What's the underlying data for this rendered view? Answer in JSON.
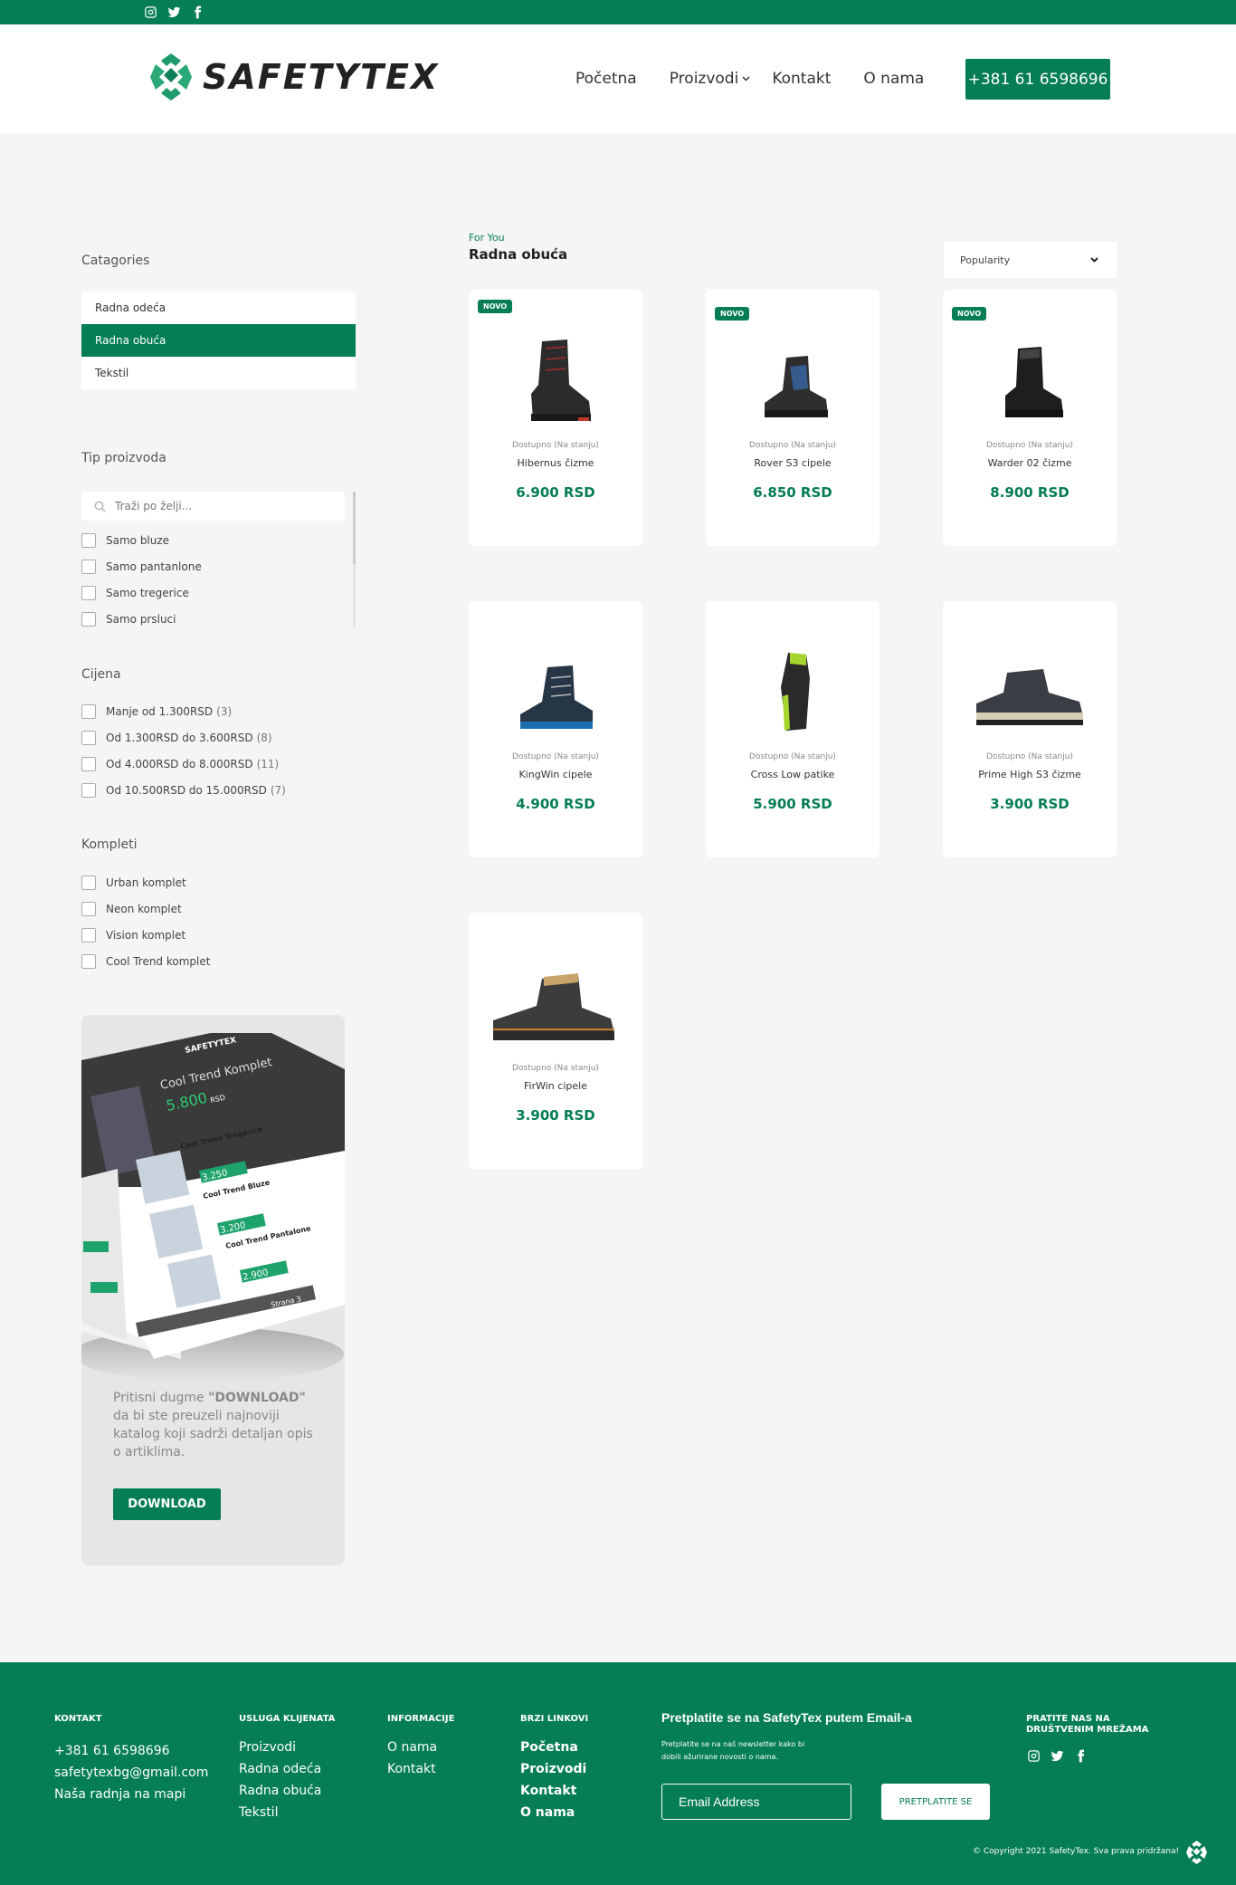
{
  "brand": {
    "name": "SAFETYTEX",
    "color": "#057d56"
  },
  "top_social": [
    "instagram-icon",
    "twitter-icon",
    "facebook-icon"
  ],
  "nav": {
    "items": [
      "Početna",
      "Proizvodi",
      "Kontakt",
      "O nama"
    ],
    "phone": "+381 61 6598696"
  },
  "sidebar": {
    "categories_title": "Catagories",
    "categories": [
      "Radna odeća",
      "Radna obuća",
      "Tekstil"
    ],
    "active_category": "Radna obuća",
    "type_title": "Tip proizvoda",
    "search_placeholder": "Traži po želji...",
    "types": [
      "Samo bluze",
      "Samo pantanlone",
      "Samo tregerice",
      "Samo prsluci"
    ],
    "price_title": "Cijena",
    "prices": [
      {
        "label": "Manje od 1.300RSD",
        "count": "(3)"
      },
      {
        "label": "Od 1.300RSD do 3.600RSD",
        "count": "(8)"
      },
      {
        "label": "Od 4.000RSD do 8.000RSD",
        "count": "(11)"
      },
      {
        "label": "Od 10.500RSD do 15.000RSD",
        "count": "(7)"
      }
    ],
    "sets_title": "Kompleti",
    "sets": [
      "Urban komplet",
      "Neon komplet",
      "Vision komplet",
      "Cool Trend komplet"
    ]
  },
  "promo": {
    "text_pre": "Pritisni dugme ",
    "text_strong": "\"DOWNLOAD\"",
    "text_post": " da bi ste preuzeli najnoviji katalog koji sadrži detaljan opis o artiklima.",
    "button": "DOWNLOAD",
    "magazine": {
      "brand": "SAFETYTEX",
      "headline": "Cool Trend Komplet",
      "price": "5.800",
      "unit": "RSD",
      "items": [
        {
          "name": "Cool Trend Tregerice",
          "price": "3.250"
        },
        {
          "name": "Cool Trend Bluze",
          "price": "3.200"
        },
        {
          "name": "Cool Trend Pantalone",
          "price": "2.900"
        }
      ],
      "page": "Strana 3"
    }
  },
  "main": {
    "eyebrow": "For You",
    "title": "Radna obuća",
    "sort": "Popularity"
  },
  "products": [
    {
      "name": "Hibernus čizme",
      "stock": "Dostupno (Na stanju)",
      "price": "6.900 RSD",
      "badge": "NOVO"
    },
    {
      "name": "Rover S3 cipele",
      "stock": "Dostupno (Na stanju)",
      "price": "6.850 RSD",
      "badge": "NOVO"
    },
    {
      "name": "Warder 02 čizme",
      "stock": "Dostupno (Na stanju)",
      "price": "8.900 RSD",
      "badge": "NOVO"
    },
    {
      "name": "KingWin cipele",
      "stock": "Dostupno (Na stanju)",
      "price": "4.900 RSD",
      "badge": ""
    },
    {
      "name": "Cross Low patike",
      "stock": "Dostupno (Na stanju)",
      "price": "5.900 RSD",
      "badge": ""
    },
    {
      "name": "Prime High S3 čizme",
      "stock": "Dostupno (Na stanju)",
      "price": "3.900 RSD",
      "badge": ""
    },
    {
      "name": "FirWin cipele",
      "stock": "Dostupno (Na stanju)",
      "price": "3.900 RSD",
      "badge": ""
    }
  ],
  "footer": {
    "kontakt": {
      "title": "KONTAKT",
      "items": [
        "+381 61 6598696",
        "safetytexbg@gmail.com",
        "Naša radnja na mapi"
      ]
    },
    "usluga": {
      "title": "USLUGA KLIJENATA",
      "items": [
        "Proizvodi",
        "Radna odeća",
        "Radna obuća",
        "Tekstil"
      ]
    },
    "info": {
      "title": "INFORMACIJE",
      "items": [
        "O nama",
        "Kontakt"
      ]
    },
    "brzi": {
      "title": "BRZI LINKOVI",
      "items": [
        "Početna",
        "Proizvodi",
        "Kontakt",
        "O nama"
      ]
    },
    "newsletter": {
      "title": "Pretplatite se na SafetyTex putem Email-a",
      "sub": "Pretplatite se na naš newsletter kako bi dobili ažurirane novosti o nama.",
      "placeholder": "Email Address",
      "button": "PRETPLATITE SE"
    },
    "social_title": "PRATITE NAS NA DRUŠTVENIM MREŽAMA",
    "copyright": "© Copyright 2021 SafetyTex. Sva prava pridržana!"
  }
}
